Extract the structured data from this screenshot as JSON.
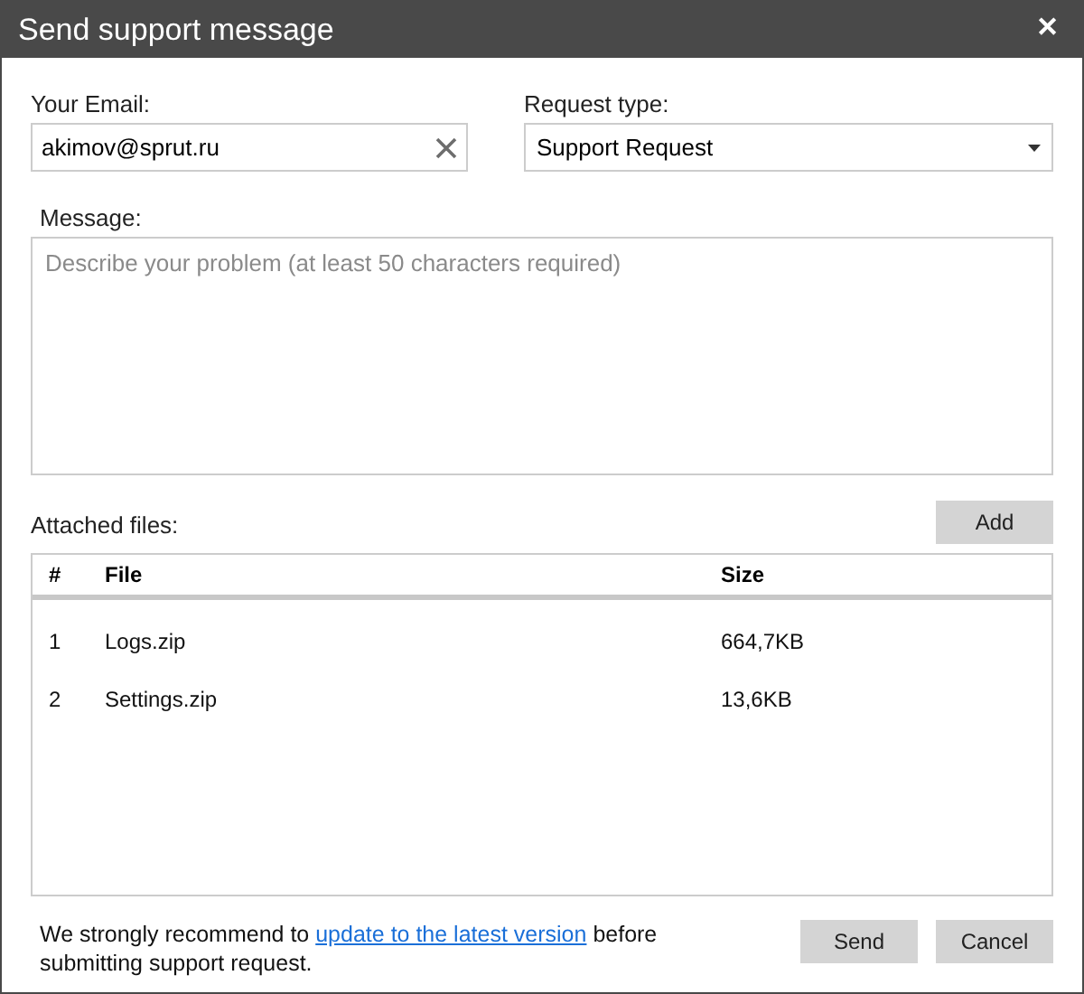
{
  "window": {
    "title": "Send support message",
    "close": "✕"
  },
  "email": {
    "label": "Your Email:",
    "value": "akimov@sprut.ru"
  },
  "request_type": {
    "label": "Request type:",
    "value": "Support Request"
  },
  "message": {
    "label": "Message:",
    "placeholder": "Describe your problem (at least 50 characters required)"
  },
  "attachments": {
    "label": "Attached files:",
    "add_button": "Add",
    "columns": [
      "#",
      "File",
      "Size"
    ],
    "rows": [
      {
        "number": "1",
        "file": "Logs.zip",
        "size": "664,7KB"
      },
      {
        "number": "2",
        "file": "Settings.zip",
        "size": "13,6KB"
      }
    ]
  },
  "notice": {
    "before": "We strongly recommend to ",
    "link": "update to the latest version",
    "after": " before submitting support request."
  },
  "buttons": [
    "Send",
    "Cancel"
  ]
}
